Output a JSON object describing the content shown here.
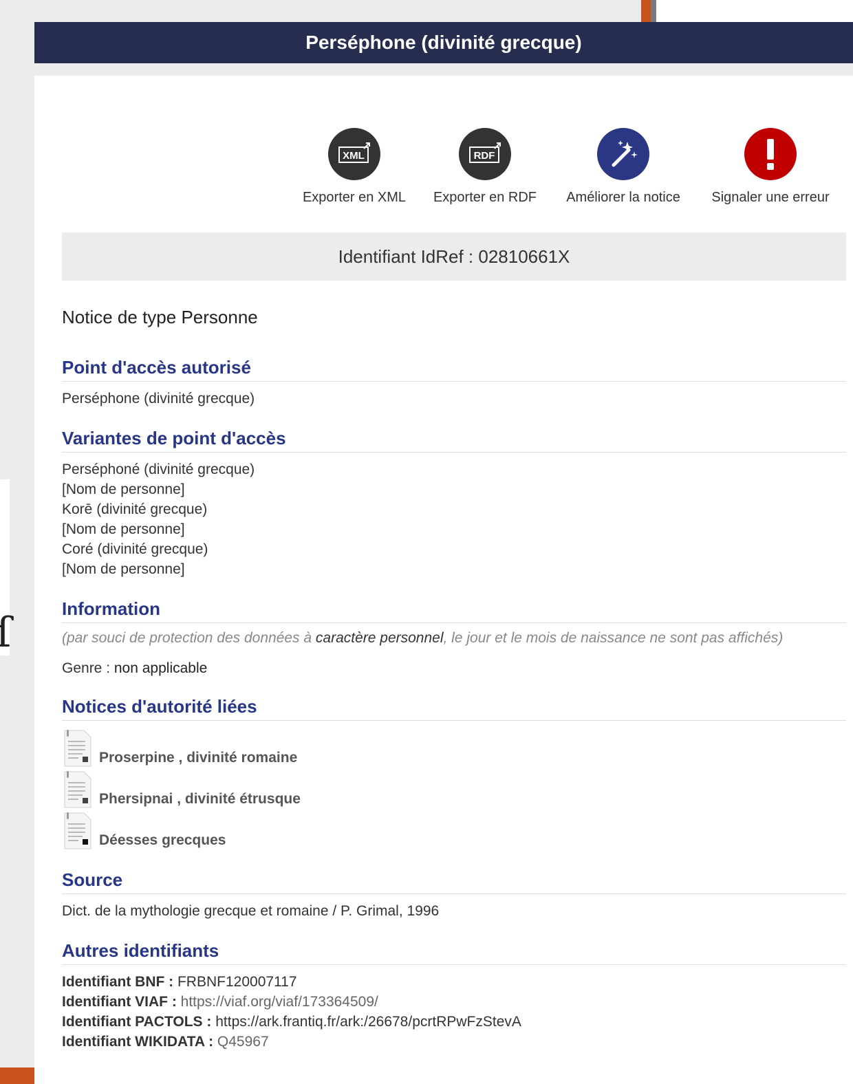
{
  "title": "Perséphone (divinité grecque)",
  "actions": [
    {
      "icon": "xml-export-icon",
      "badge": "XML",
      "label": "Exporter en XML"
    },
    {
      "icon": "rdf-export-icon",
      "badge": "RDF",
      "label": "Exporter en RDF"
    },
    {
      "icon": "magic-wand-icon",
      "label": "Améliorer la notice"
    },
    {
      "icon": "exclamation-icon",
      "label": "Signaler une erreur"
    }
  ],
  "idref": "Identifiant IdRef : 02810661X",
  "notice_type": {
    "label": "Notice de type",
    "value": "Personne"
  },
  "sections": {
    "authorized": {
      "title": "Point d'accès autorisé",
      "value": "Perséphone (divinité grecque)"
    },
    "variants": {
      "title": "Variantes de point d'accès",
      "lines": [
        "Perséphoné (divinité grecque)",
        "[Nom de personne]",
        "Korē (divinité grecque)",
        "[Nom de personne]",
        "Coré (divinité grecque)",
        "[Nom de personne]"
      ]
    },
    "information": {
      "title": "Information",
      "note_before": "(par souci de protection des données à ",
      "note_em": "caractère personnel",
      "note_after": ", le jour et le mois de naissance ne sont pas affichés)",
      "genre_label": "Genre : ",
      "genre_value": "non applicable"
    },
    "linked": {
      "title": "Notices d'autorité liées",
      "items": [
        "Proserpine , divinité romaine",
        "Phersipnai , divinité étrusque",
        "Déesses grecques"
      ]
    },
    "source": {
      "title": "Source",
      "value": "Dict. de la mythologie grecque et romaine / P. Grimal, 1996"
    },
    "others": {
      "title": "Autres identifiants",
      "rows": [
        {
          "label": "Identifiant BNF : ",
          "value": "FRBNF120007117"
        },
        {
          "label": "Identifiant VIAF : ",
          "value": "https://viaf.org/viaf/173364509/"
        },
        {
          "label": "Identifiant PACTOLS : ",
          "value": "https://ark.frantiq.fr/ark:/26678/pcrtRPwFzStevA"
        },
        {
          "label": "Identifiant WIKIDATA : ",
          "value": "Q45967"
        }
      ]
    }
  }
}
